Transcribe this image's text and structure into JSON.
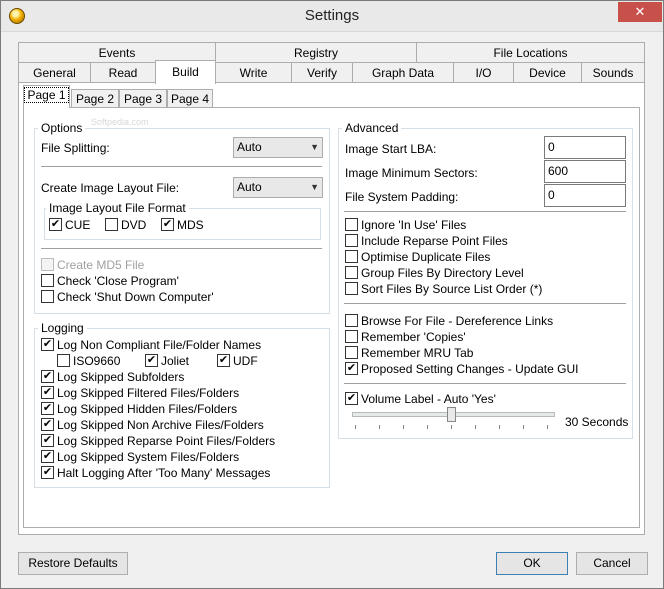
{
  "window": {
    "title": "Settings",
    "close_glyph": "✕"
  },
  "tabs_row1": [
    "Events",
    "Registry",
    "File Locations"
  ],
  "tabs_row2": [
    "General",
    "Read",
    "Build",
    "Write",
    "Verify",
    "Graph Data",
    "I/O",
    "Device",
    "Sounds"
  ],
  "active_tab": "Build",
  "subtabs": [
    "Page 1",
    "Page 2",
    "Page 3",
    "Page 4"
  ],
  "active_subtab": "Page 1",
  "watermark": "Softpedia.com",
  "options": {
    "label": "Options",
    "file_splitting_label": "File Splitting:",
    "file_splitting_value": "Auto",
    "create_layout_label": "Create Image Layout File:",
    "create_layout_value": "Auto",
    "format_group_label": "Image Layout File Format",
    "formats": [
      {
        "label": "CUE",
        "checked": true
      },
      {
        "label": "DVD",
        "checked": false
      },
      {
        "label": "MDS",
        "checked": true
      }
    ],
    "create_md5": {
      "label": "Create MD5 File",
      "checked": false,
      "disabled": true
    },
    "check_close": {
      "label": "Check 'Close Program'",
      "checked": false
    },
    "check_shutdown": {
      "label": "Check 'Shut Down Computer'",
      "checked": false
    }
  },
  "logging": {
    "label": "Logging",
    "items": [
      {
        "label": "Log Non Compliant File/Folder Names",
        "checked": true
      },
      {
        "label": "Log Skipped Subfolders",
        "checked": true
      },
      {
        "label": "Log Skipped Filtered Files/Folders",
        "checked": true
      },
      {
        "label": "Log Skipped Hidden Files/Folders",
        "checked": true
      },
      {
        "label": "Log Skipped Non Archive Files/Folders",
        "checked": true
      },
      {
        "label": "Log Skipped Reparse Point Files/Folders",
        "checked": true
      },
      {
        "label": "Log Skipped System Files/Folders",
        "checked": true
      },
      {
        "label": "Halt Logging After 'Too Many' Messages",
        "checked": true
      }
    ],
    "sub_items": [
      {
        "label": "ISO9660",
        "checked": false
      },
      {
        "label": "Joliet",
        "checked": true
      },
      {
        "label": "UDF",
        "checked": true
      }
    ]
  },
  "advanced": {
    "label": "Advanced",
    "start_lba_label": "Image Start LBA:",
    "start_lba_value": "0",
    "min_sectors_label": "Image Minimum Sectors:",
    "min_sectors_value": "600",
    "padding_label": "File System Padding:",
    "padding_value": "0",
    "group1": [
      {
        "label": "Ignore 'In Use' Files",
        "checked": false
      },
      {
        "label": "Include Reparse Point Files",
        "checked": false
      },
      {
        "label": "Optimise Duplicate Files",
        "checked": false
      },
      {
        "label": "Group Files By Directory Level",
        "checked": false
      },
      {
        "label": "Sort Files By Source List Order (*)",
        "checked": false
      }
    ],
    "group2": [
      {
        "label": "Browse For File - Dereference Links",
        "checked": false
      },
      {
        "label": "Remember 'Copies'",
        "checked": false
      },
      {
        "label": "Remember MRU Tab",
        "checked": false
      },
      {
        "label": "Proposed Setting Changes - Update GUI",
        "checked": true
      }
    ],
    "volume_label": {
      "label": "Volume Label - Auto 'Yes'",
      "checked": true
    },
    "slider_value_text": "30 Seconds"
  },
  "buttons": {
    "restore": "Restore Defaults",
    "ok": "OK",
    "cancel": "Cancel"
  }
}
